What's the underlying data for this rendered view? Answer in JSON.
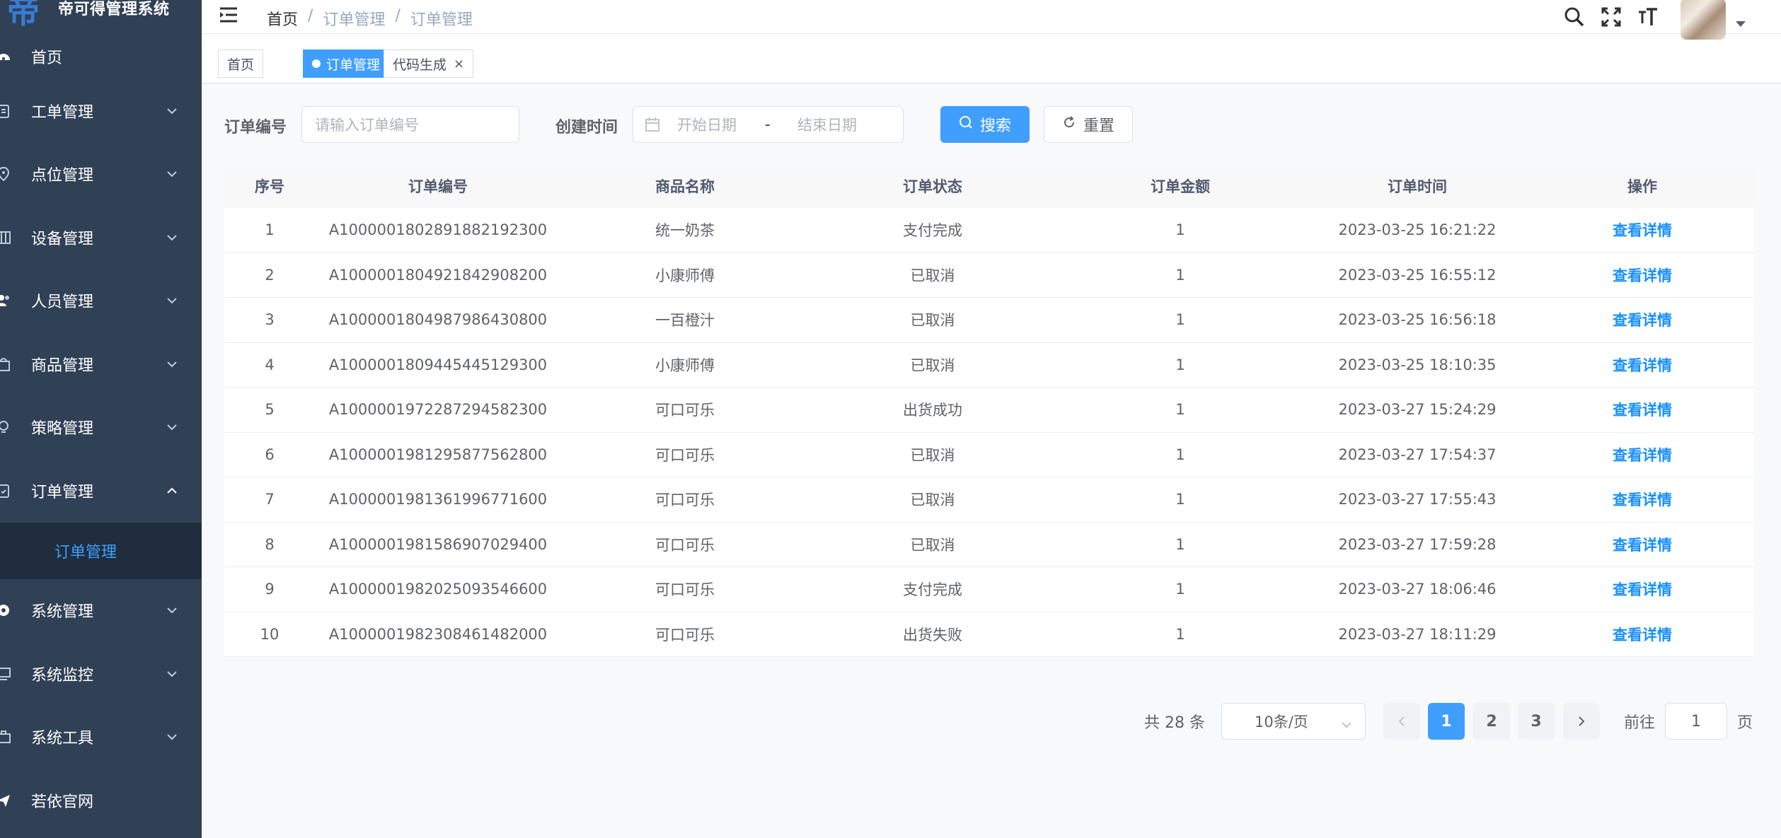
{
  "app": {
    "title": "帝可得管理系统",
    "logo_char": "帝"
  },
  "sidebar": {
    "items": [
      {
        "label": "首页",
        "icon": "dashboard-icon"
      },
      {
        "label": "工单管理",
        "icon": "clipboard-icon"
      },
      {
        "label": "点位管理",
        "icon": "location-pin-icon"
      },
      {
        "label": "设备管理",
        "icon": "device-icon"
      },
      {
        "label": "人员管理",
        "icon": "people-icon"
      },
      {
        "label": "商品管理",
        "icon": "shopping-bag-icon"
      },
      {
        "label": "策略管理",
        "icon": "bulb-icon"
      },
      {
        "label": "订单管理",
        "icon": "order-icon"
      }
    ],
    "active_submenu": "订单管理",
    "bottom_items": [
      {
        "label": "系统管理",
        "icon": "gear-icon"
      },
      {
        "label": "系统监控",
        "icon": "monitor-icon"
      },
      {
        "label": "系统工具",
        "icon": "toolbox-icon"
      },
      {
        "label": "若依官网",
        "icon": "send-icon"
      }
    ]
  },
  "header": {
    "breadcrumb": [
      "首页",
      "/",
      "订单管理",
      "/",
      "订单管理"
    ]
  },
  "tags": [
    {
      "label": "首页",
      "active": false
    },
    {
      "label": "订单管理",
      "active": true
    },
    {
      "label": "代码生成",
      "active": false
    }
  ],
  "search": {
    "order_no_label": "订单编号",
    "order_no_placeholder": "请输入订单编号",
    "created_label": "创建时间",
    "start_placeholder": "开始日期",
    "range_sep": "-",
    "end_placeholder": "结束日期",
    "search_btn": "搜索",
    "reset_btn": "重置"
  },
  "table": {
    "columns": [
      "序号",
      "订单编号",
      "商品名称",
      "订单状态",
      "订单金额",
      "订单时间",
      "操作"
    ],
    "rows": [
      [
        "1",
        "A100000180289188219230​0",
        "统一奶茶",
        "支付完成",
        "1",
        "2023-03-25 16:21:22",
        "查看详情"
      ],
      [
        "2",
        "A1000001804921842908200",
        "小康师傅",
        "已取消",
        "1",
        "2023-03-25 16:55:12",
        "查看详情"
      ],
      [
        "3",
        "A1000001804987986430800",
        "一百橙汁",
        "已取消",
        "1",
        "2023-03-25 16:56:18",
        "查看详情"
      ],
      [
        "4",
        "A1000001809445445129300",
        "小康师傅",
        "已取消",
        "1",
        "2023-03-25 18:10:35",
        "查看详情"
      ],
      [
        "5",
        "A1000001972287294582300",
        "可口可乐",
        "出货成功",
        "1",
        "2023-03-27 15:24:29",
        "查看详情"
      ],
      [
        "6",
        "A1000001981295877562800",
        "可口可乐",
        "已取消",
        "1",
        "2023-03-27 17:54:37",
        "查看详情"
      ],
      [
        "7",
        "A1000001981361996771600",
        "可口可乐",
        "已取消",
        "1",
        "2023-03-27 17:55:43",
        "查看详情"
      ],
      [
        "8",
        "A1000001981586907029400",
        "可口可乐",
        "已取消",
        "1",
        "2023-03-27 17:59:28",
        "查看详情"
      ],
      [
        "9",
        "A1000001982025093546600",
        "可口可乐",
        "支付完成",
        "1",
        "2023-03-27 18:06:46",
        "查看详情"
      ],
      [
        "10",
        "A1000001982308461482000",
        "可口可乐",
        "出货失败",
        "1",
        "2023-03-27 18:11:29",
        "查看详情"
      ]
    ]
  },
  "pagination": {
    "total_text": "共 28 条",
    "page_size": "10条/页",
    "pages": [
      "1",
      "2",
      "3"
    ],
    "current": "1",
    "goto_label": "前往",
    "goto_value": "1",
    "page_unit": "页"
  },
  "colors": {
    "sidebar_bg": "#304156",
    "primary": "#409eff",
    "submenu_bg": "#1f2d3d"
  }
}
